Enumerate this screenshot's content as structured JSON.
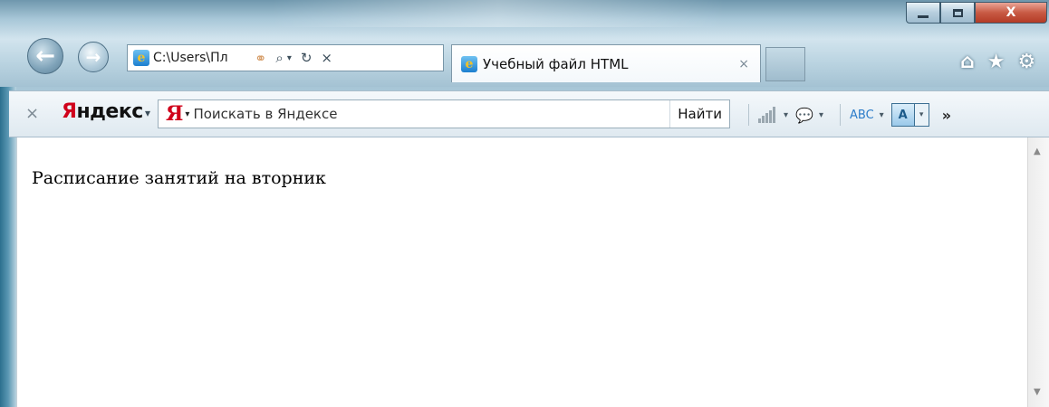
{
  "window": {
    "controls": {
      "minimize": "minimize",
      "maximize": "maximize",
      "close_label": "X"
    }
  },
  "navigation": {
    "back_icon": "←",
    "forward_icon": "→"
  },
  "address_bar": {
    "url": "C:\\Users\\Пл",
    "search_icon": "⌕",
    "dropdown_icon": "▾",
    "refresh_icon": "↻",
    "stop_icon": "×"
  },
  "tab": {
    "title": "Учебный файл HTML",
    "close_icon": "×"
  },
  "right_icons": {
    "home": "⌂",
    "favorites": "★",
    "settings": "⚙"
  },
  "yandex_toolbar": {
    "close_icon": "×",
    "logo_first": "Я",
    "logo_rest": "ндекс",
    "logo_caret": "▾",
    "search_mark": "Я",
    "search_placeholder": "Поискать в Яндексе",
    "find_button": "Найти",
    "spell_icon": "ABC",
    "chevron": "»"
  },
  "page": {
    "text": "Расписание занятий на вторник"
  },
  "colors": {
    "yandex_red": "#d0021b",
    "close_button": "#c85a44"
  }
}
